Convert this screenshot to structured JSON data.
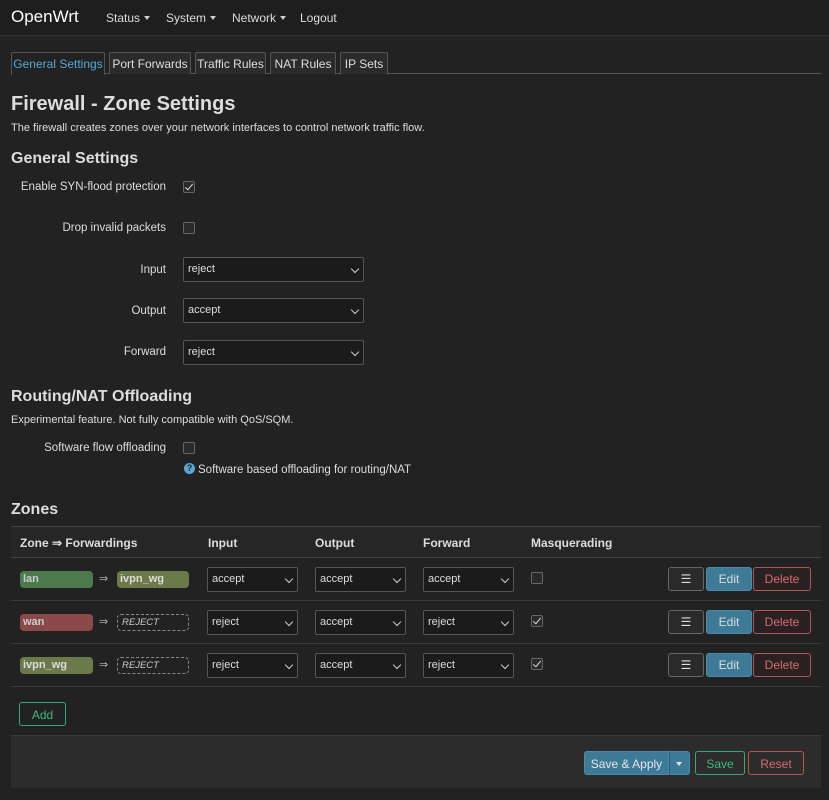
{
  "brand": "OpenWrt",
  "nav": {
    "status": "Status",
    "system": "System",
    "network": "Network",
    "logout": "Logout"
  },
  "tabs": [
    "General Settings",
    "Port Forwards",
    "Traffic Rules",
    "NAT Rules",
    "IP Sets"
  ],
  "page_title": "Firewall - Zone Settings",
  "page_description": "The firewall creates zones over your network interfaces to control network traffic flow.",
  "general": {
    "heading": "General Settings",
    "syn_flood_label": "Enable SYN-flood protection",
    "syn_flood_checked": true,
    "drop_invalid_label": "Drop invalid packets",
    "drop_invalid_checked": false,
    "input_label": "Input",
    "input_value": "reject",
    "output_label": "Output",
    "output_value": "accept",
    "forward_label": "Forward",
    "forward_value": "reject"
  },
  "offloading": {
    "heading": "Routing/NAT Offloading",
    "description": "Experimental feature. Not fully compatible with QoS/SQM.",
    "software_label": "Software flow offloading",
    "software_checked": false,
    "help_text": "Software based offloading for routing/NAT"
  },
  "zones": {
    "heading": "Zones",
    "columns": {
      "zone": "Zone ⇒ Forwardings",
      "input": "Input",
      "output": "Output",
      "forward": "Forward",
      "masquerading": "Masquerading"
    },
    "arrow": "⇒",
    "rows": [
      {
        "name": "lan",
        "color": "#4d7a4d",
        "target": "ivpn_wg",
        "target_color": "#6b7a4a",
        "input": "accept",
        "output": "accept",
        "forward": "accept",
        "masq": false
      },
      {
        "name": "wan",
        "color": "#8a4a4a",
        "target": "REJECT",
        "input": "reject",
        "output": "accept",
        "forward": "reject",
        "masq": true
      },
      {
        "name": "ivpn_wg",
        "color": "#6b7a4a",
        "target": "REJECT",
        "input": "reject",
        "output": "accept",
        "forward": "reject",
        "masq": true
      }
    ],
    "more_label": "☰",
    "edit_label": "Edit",
    "delete_label": "Delete",
    "add_label": "Add"
  },
  "footer": {
    "save_apply_label": "Save & Apply",
    "save_label": "Save",
    "reset_label": "Reset"
  }
}
